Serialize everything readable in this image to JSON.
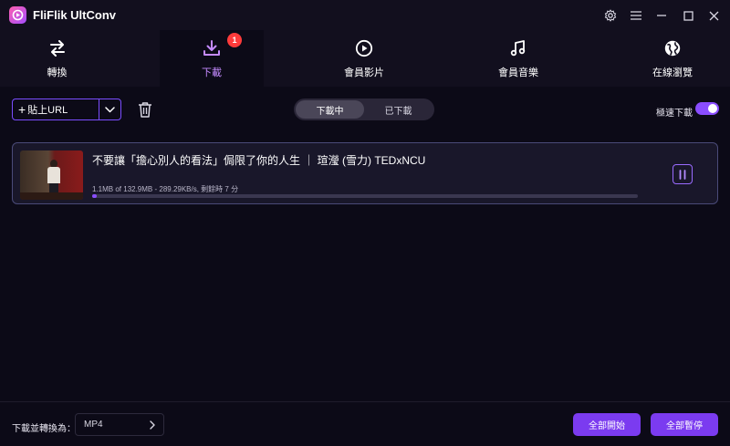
{
  "app": {
    "title": "FliFlik UltConv"
  },
  "tabs": [
    {
      "label": "轉換",
      "icon": "swap-arrows-icon"
    },
    {
      "label": "下載",
      "icon": "download-icon",
      "badge": "1"
    },
    {
      "label": "會員影片",
      "icon": "play-circle-icon"
    },
    {
      "label": "會員音樂",
      "icon": "music-note-icon"
    },
    {
      "label": "在線瀏覽",
      "icon": "globe-icon"
    }
  ],
  "toolbar": {
    "paste_url_label": "貼上URL",
    "segment": {
      "downloading": "下載中",
      "downloaded": "已下載",
      "selected": "下載中"
    },
    "turbo_label": "極速下載",
    "turbo_on": true
  },
  "downloads": [
    {
      "title": "不要讓「擔心別人的看法」侷限了你的人生 ｜ 瑄瀅 (雪力) TEDxNCU",
      "meta": "1.1MB of 132.9MB -  289.29KB/s, 剩餘時 7 分",
      "progress_fraction": 0.008
    }
  ],
  "bottom": {
    "convert_label": "下載並轉換為：",
    "format": "MP4",
    "start_all": "全部開始",
    "pause_all": "全部暫停"
  },
  "colors": {
    "accent": "#7b3bf0",
    "active_tab_text": "#c58bff",
    "badge": "#ff3b3b"
  }
}
